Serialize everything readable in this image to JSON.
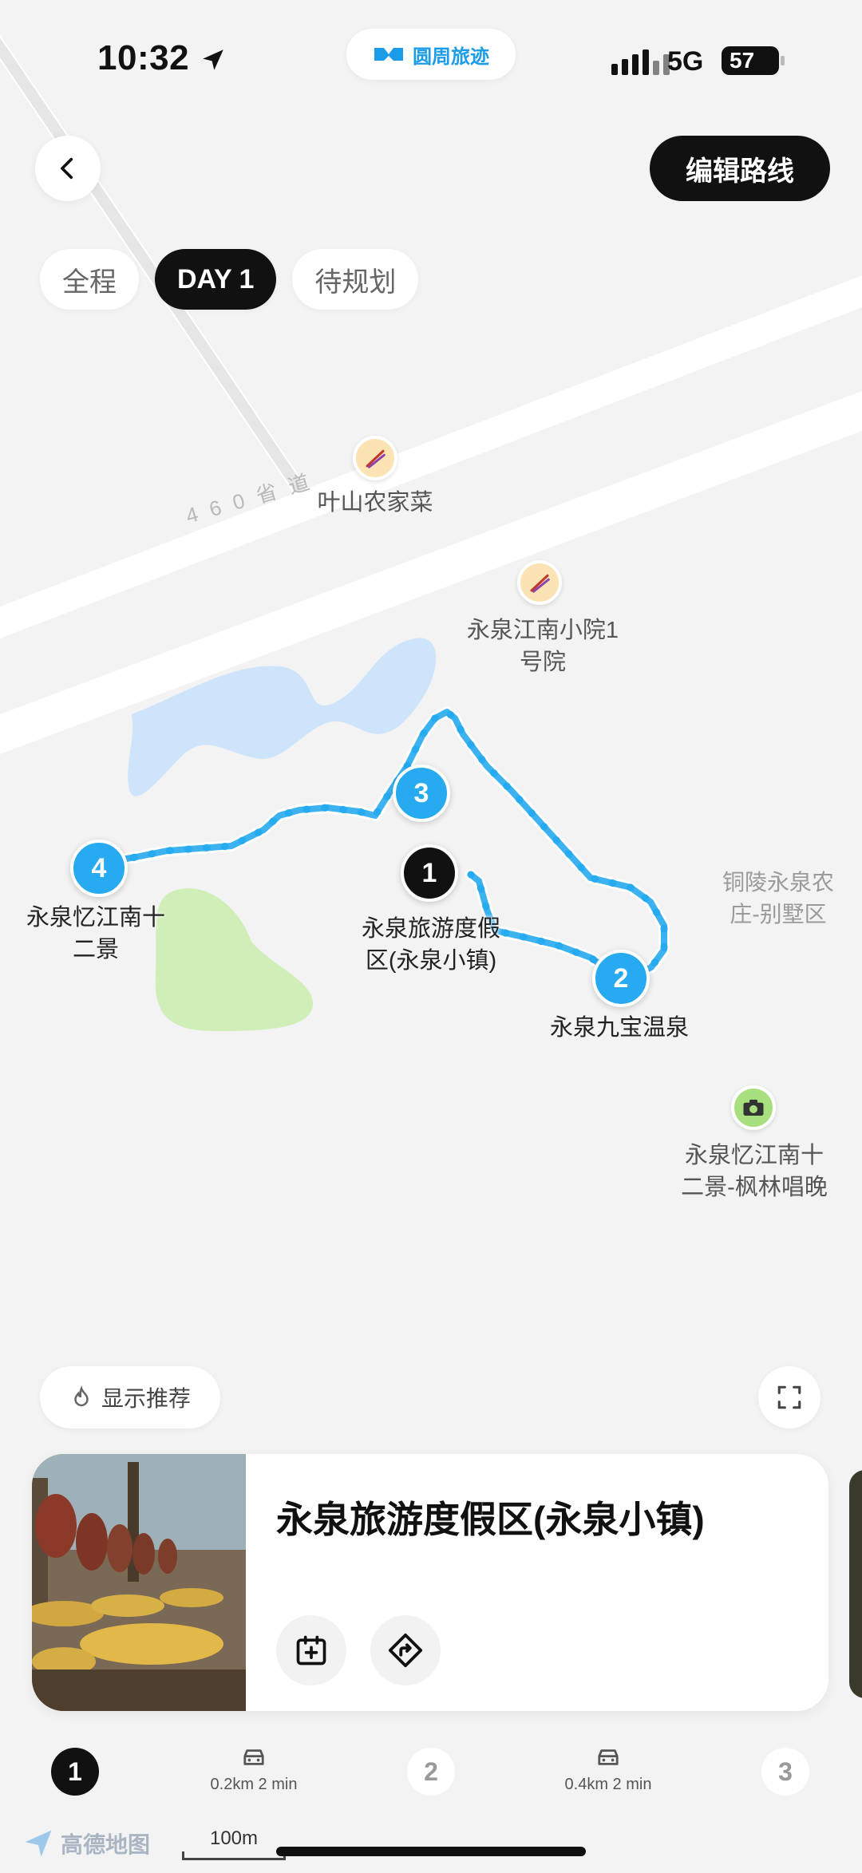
{
  "status_bar": {
    "time": "10:32",
    "network": "5G",
    "battery": "57"
  },
  "app_pill": {
    "label": "圆周旅迹"
  },
  "header": {
    "edit_label": "编辑路线"
  },
  "tabs": [
    {
      "label": "全程",
      "active": false
    },
    {
      "label": "DAY 1",
      "active": true
    },
    {
      "label": "待规划",
      "active": false
    }
  ],
  "map": {
    "road_label": "460省道",
    "pois": [
      {
        "name": "叶山农家菜",
        "icon": "chopsticks-icon"
      },
      {
        "name_lines": [
          "永泉江南小院1",
          "号院"
        ],
        "icon": "chopsticks-icon"
      },
      {
        "name_lines": [
          "永泉忆江南十",
          "二景-枫林唱晚"
        ],
        "icon": "camera-icon"
      },
      {
        "name_lines": [
          "铜陵永泉农",
          "庄-别墅区"
        ]
      }
    ],
    "stops": [
      {
        "number": "1",
        "name_lines": [
          "永泉旅游度假",
          "区(永泉小镇)"
        ]
      },
      {
        "number": "2",
        "name": "永泉九宝温泉"
      },
      {
        "number": "3"
      },
      {
        "number": "4",
        "name_lines": [
          "永泉忆江南十",
          "二景"
        ]
      }
    ],
    "scale_label": "100m",
    "provider": "高德地图"
  },
  "controls": {
    "recommend_label": "显示推荐"
  },
  "card": {
    "title": "永泉旅游度假区(永泉小镇)"
  },
  "route_bar": {
    "stops": [
      "1",
      "2",
      "3"
    ],
    "segments": [
      {
        "distance_time": "0.2km 2 min",
        "mode": "car-icon"
      },
      {
        "distance_time": "0.4km 2 min",
        "mode": "car-icon"
      }
    ]
  },
  "colors": {
    "route": "#27aaf0",
    "water": "#cde4fb",
    "park": "#cfeeb8",
    "accent": "#111111"
  }
}
